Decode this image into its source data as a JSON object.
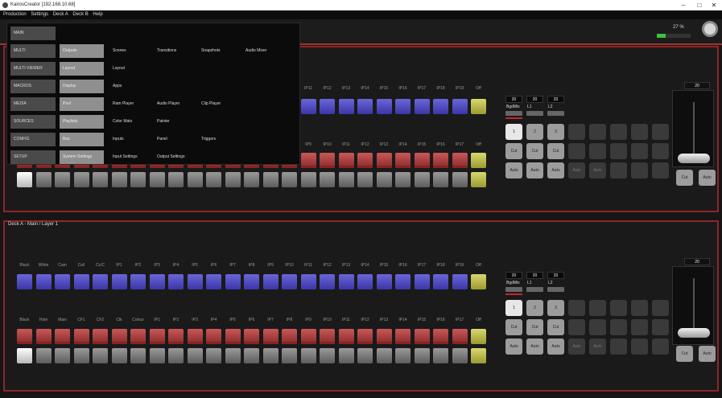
{
  "window": {
    "title": "KairosCreator [192.168.10.68]",
    "icon": "app-icon",
    "controls": [
      "–",
      "□",
      "✕"
    ]
  },
  "menubar": [
    "Production",
    "Settings",
    "Deck A",
    "Deck B",
    "Help"
  ],
  "status": {
    "percent_label": "27 %",
    "percent": 27
  },
  "menu": {
    "categories": [
      "MAIN",
      "MULTI",
      "MULTI VIEWER",
      "MACROS",
      "MEDIA",
      "SOURCES",
      "CONFIG",
      "SETUP"
    ],
    "subitems": [
      "Outputs",
      "Layout",
      "Display",
      "Pool",
      "Playlists",
      "Bus",
      "System Settings"
    ],
    "items": [
      [
        "Scenes",
        "Transitions",
        "Snapshots",
        "Audio Mixer"
      ],
      [
        "Layout"
      ],
      [
        "Apps"
      ],
      [
        "Ram Player",
        "Audio Player",
        "Clip Player"
      ],
      [
        "Color Mats",
        "Painter"
      ],
      [
        "Inputs",
        "Panel",
        "Triggers"
      ],
      [
        "Input Settings",
        "Output Settings"
      ]
    ]
  },
  "deck_b": {
    "title": "Deck A - Main / Layer 1"
  },
  "deck_a": {
    "top_labels": [
      "IP11",
      "IP12",
      "IP13",
      "IP14",
      "IP15",
      "IP16",
      "IP17",
      "IP18",
      "IP19",
      "Off"
    ],
    "mid_labels": [
      "IP9",
      "IP10",
      "IP11",
      "IP12",
      "IP13",
      "IP14",
      "IP15",
      "IP16",
      "IP17",
      "Off"
    ]
  },
  "deck2_labels": {
    "top": [
      "Black",
      "White",
      "Cam",
      "Cell",
      "Cc/C",
      "IP1",
      "IP2",
      "IP3",
      "IP4",
      "IP5",
      "IP6",
      "IP7",
      "IP8",
      "IP9",
      "IP10",
      "IP11",
      "IP12",
      "IP13",
      "IP14",
      "IP15",
      "IP16",
      "IP17",
      "IP18",
      "IP19",
      "Off"
    ],
    "mid": [
      "Black",
      "Hole",
      "Main",
      "CF1",
      "CF2",
      "Clk",
      "Colour",
      "IP1",
      "IP2",
      "IP3",
      "IP4",
      "IP5",
      "IP6",
      "IP7",
      "IP8",
      "IP9",
      "IP10",
      "IP11",
      "IP12",
      "IP13",
      "IP14",
      "IP15",
      "IP16",
      "IP17",
      "Off"
    ]
  },
  "transition_panel": {
    "values": [
      "20",
      "20",
      "20"
    ],
    "labels": [
      "BgdMix",
      "L1",
      "L2"
    ],
    "numbers": [
      "1",
      "2",
      "3"
    ],
    "cut": "Cut",
    "auto": "Auto",
    "tbar_value": "20"
  },
  "colors": {
    "accent_red": "#a83030",
    "blue_bus": "#4a46c8",
    "red_bus": "#a84040",
    "progress": "#3ec23e"
  }
}
